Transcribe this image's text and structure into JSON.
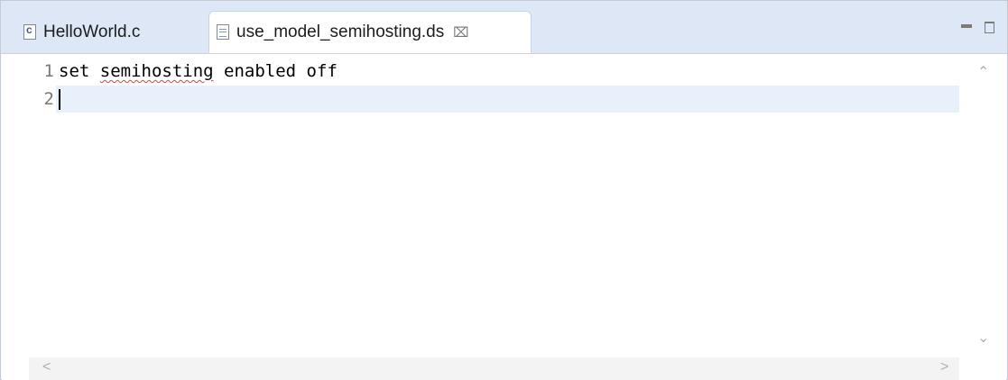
{
  "tabs": [
    {
      "label": "HelloWorld.c",
      "icon": "c-file-icon",
      "active": false
    },
    {
      "label": "use_model_semihosting.ds",
      "icon": "text-file-icon",
      "active": true,
      "close_glyph": "⌧"
    }
  ],
  "window_controls": {
    "minimize": "minimize-icon",
    "maximize": "maximize-icon"
  },
  "editor": {
    "line_numbers": [
      "1",
      "2"
    ],
    "lines": [
      {
        "before": "set ",
        "squiggle": "semihosting",
        "after": " enabled off"
      },
      {
        "before": "",
        "squiggle": "",
        "after": ""
      }
    ],
    "current_line": 2
  },
  "scrollbars": {
    "up_arrow": "⌃",
    "down_arrow": "⌄",
    "left_arrow": "<",
    "right_arrow": ">"
  },
  "colors": {
    "tabbar_bg": "#dde7f5",
    "current_line_bg": "#e8f0fb",
    "squiggle": "#e04040"
  }
}
